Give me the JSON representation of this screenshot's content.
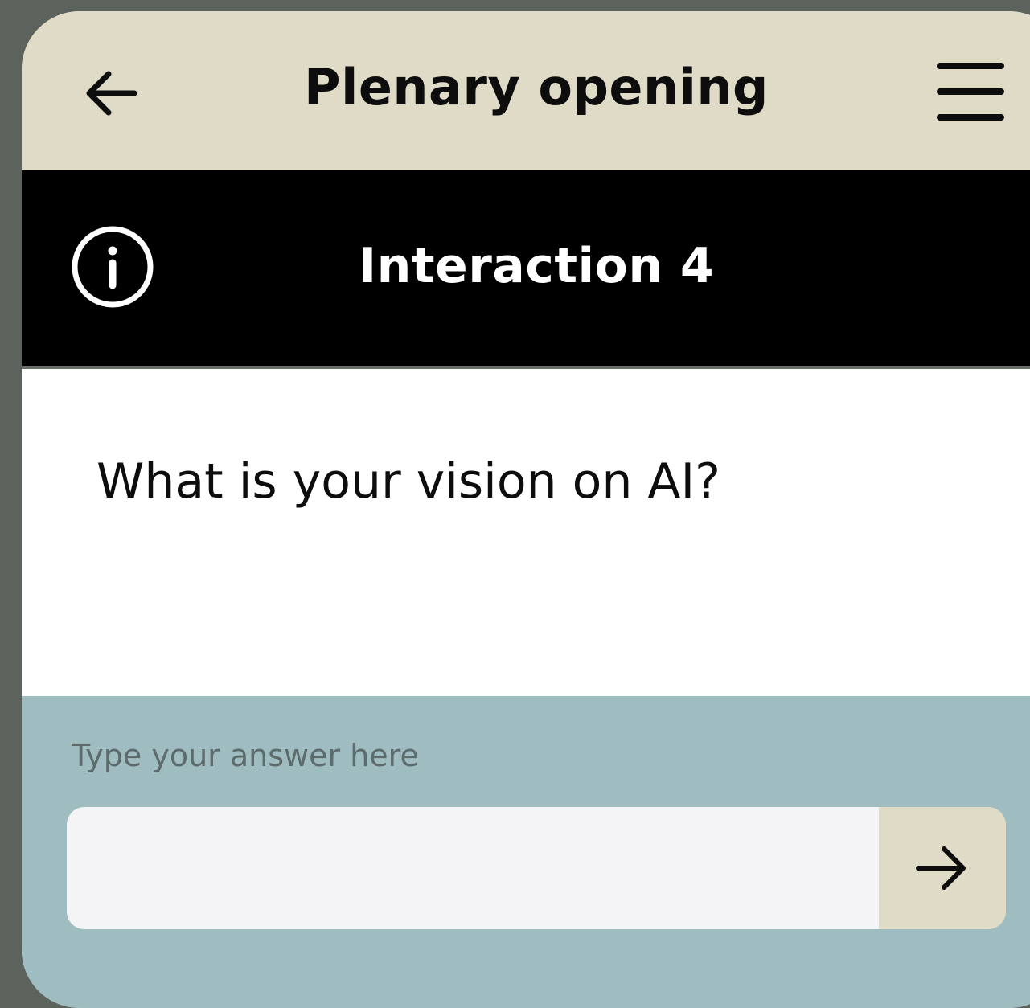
{
  "header": {
    "title": "Plenary opening",
    "back_icon": "arrow-left-icon",
    "menu_icon": "hamburger-menu-icon"
  },
  "banner": {
    "title": "Interaction 4",
    "info_icon": "info-icon"
  },
  "question": {
    "text": "What is your vision on AI?"
  },
  "answer": {
    "label": "Type your answer here",
    "value": "",
    "placeholder": "",
    "submit_icon": "arrow-right-icon"
  },
  "colors": {
    "header_bg": "#e0dbc6",
    "banner_bg": "#000000",
    "answer_bg": "#9fbdc0",
    "input_bg": "#f4f4f6",
    "page_bg": "#5b635c"
  }
}
